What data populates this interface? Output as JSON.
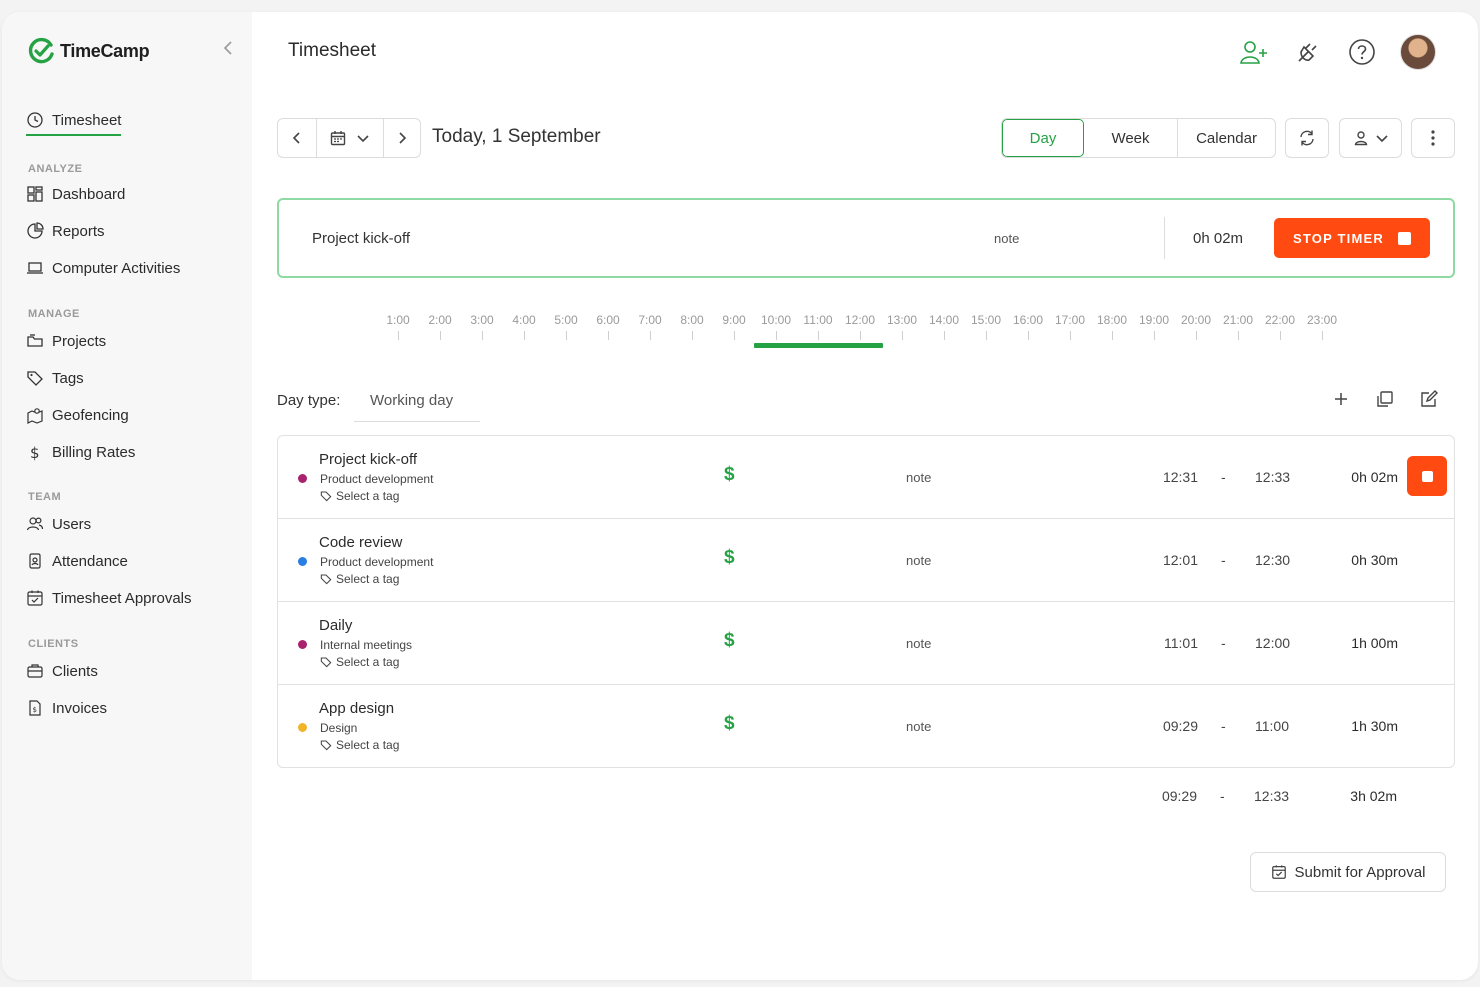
{
  "app": {
    "brand": "TimeCamp",
    "accent": "#25a244",
    "stop_color": "#ff4b12"
  },
  "sidebar": {
    "timesheet": "Timesheet",
    "sections": [
      {
        "label": "ANALYZE",
        "items": [
          "Dashboard",
          "Reports",
          "Computer Activities"
        ]
      },
      {
        "label": "MANAGE",
        "items": [
          "Projects",
          "Tags",
          "Geofencing",
          "Billing Rates"
        ]
      },
      {
        "label": "TEAM",
        "items": [
          "Users",
          "Attendance",
          "Timesheet Approvals"
        ]
      },
      {
        "label": "CLIENTS",
        "items": [
          "Clients",
          "Invoices"
        ]
      }
    ]
  },
  "header": {
    "title": "Timesheet"
  },
  "toolbar": {
    "date": "Today, 1 September",
    "views": [
      "Day",
      "Week",
      "Calendar"
    ],
    "active_view": "Day"
  },
  "timer": {
    "task": "Project kick-off",
    "note": "note",
    "duration": "0h 02m",
    "stop_label": "STOP TIMER"
  },
  "timeline": {
    "hours": [
      "1:00",
      "2:00",
      "3:00",
      "4:00",
      "5:00",
      "6:00",
      "7:00",
      "8:00",
      "9:00",
      "10:00",
      "11:00",
      "12:00",
      "13:00",
      "14:00",
      "15:00",
      "16:00",
      "17:00",
      "18:00",
      "19:00",
      "20:00",
      "21:00",
      "22:00",
      "23:00"
    ],
    "tracked_from": "09:29",
    "tracked_to": "12:33"
  },
  "day_type": {
    "label": "Day type:",
    "value": "Working day"
  },
  "entries": [
    {
      "task": "Project kick-off",
      "project": "Product development",
      "tag": "Select a tag",
      "dot_color": "#a8226e",
      "billable": "$",
      "note": "note",
      "start": "12:31",
      "dash": "-",
      "end": "12:33",
      "duration": "0h 02m",
      "running": true
    },
    {
      "task": "Code review",
      "project": "Product development",
      "tag": "Select a tag",
      "dot_color": "#2a7de1",
      "billable": "$",
      "note": "note",
      "start": "12:01",
      "dash": "-",
      "end": "12:30",
      "duration": "0h 30m",
      "running": false
    },
    {
      "task": "Daily",
      "project": "Internal meetings",
      "tag": "Select a tag",
      "dot_color": "#a8226e",
      "billable": "$",
      "note": "note",
      "start": "11:01",
      "dash": "-",
      "end": "12:00",
      "duration": "1h 00m",
      "running": false
    },
    {
      "task": "App design",
      "project": "Design",
      "tag": "Select a tag",
      "dot_color": "#f0b429",
      "billable": "$",
      "note": "note",
      "start": "09:29",
      "dash": "-",
      "end": "11:00",
      "duration": "1h 30m",
      "running": false
    }
  ],
  "totals": {
    "start": "09:29",
    "dash": "-",
    "end": "12:33",
    "duration": "3h 02m"
  },
  "submit_label": "Submit for Approval"
}
